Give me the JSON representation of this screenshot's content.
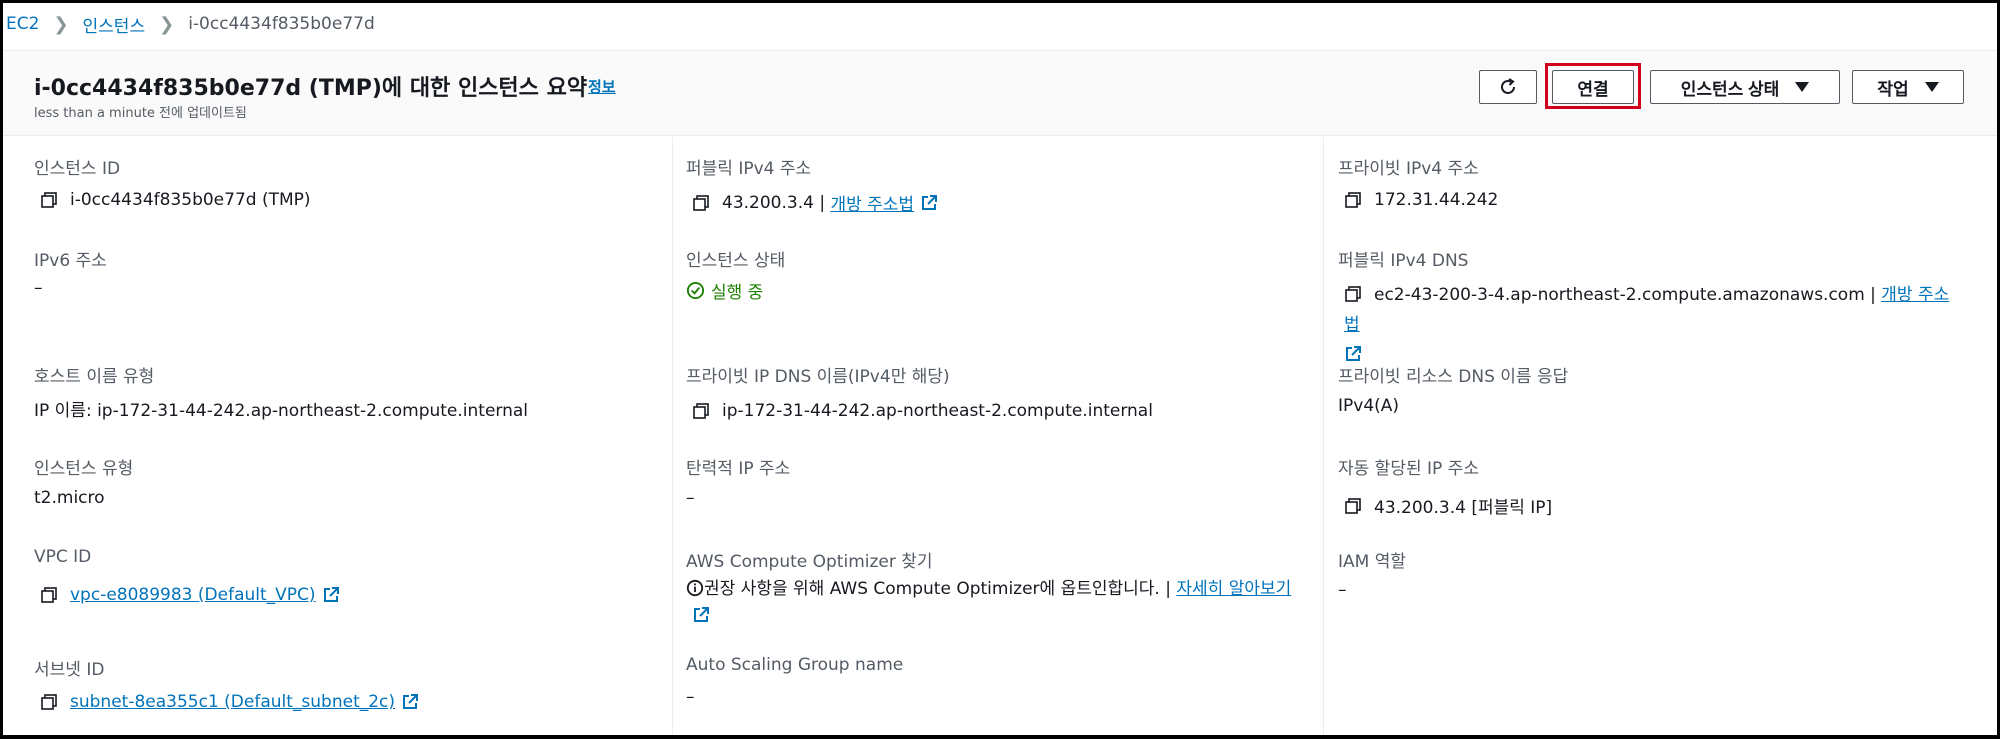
{
  "breadcrumb": {
    "root": "EC2",
    "section": "인스턴스",
    "current": "i-0cc4434f835b0e77d"
  },
  "header": {
    "title": "i-0cc4434f835b0e77d (TMP)에 대한 인스턴스 요약",
    "info_link": "정보",
    "updated": "less than a minute 전에 업데이트됨"
  },
  "actions": {
    "connect": "연결",
    "instance_state": "인스턴스 상태",
    "actions": "작업"
  },
  "col1": {
    "instance_id_label": "인스턴스 ID",
    "instance_id_value": "i-0cc4434f835b0e77d (TMP)",
    "ipv6_label": "IPv6 주소",
    "ipv6_value": "–",
    "hostname_type_label": "호스트 이름 유형",
    "hostname_type_value": "IP 이름: ip-172-31-44-242.ap-northeast-2.compute.internal",
    "instance_type_label": "인스턴스 유형",
    "instance_type_value": "t2.micro",
    "vpc_label": "VPC ID",
    "vpc_value": "vpc-e8089983 (Default_VPC)",
    "subnet_label": "서브넷 ID",
    "subnet_value": "subnet-8ea355c1 (Default_subnet_2c)"
  },
  "col2": {
    "public_ipv4_label": "퍼블릭 IPv4 주소",
    "public_ipv4_value": "43.200.3.4 |",
    "public_ipv4_link": "개방 주소법",
    "state_label": "인스턴스 상태",
    "state_value": "실행 중",
    "private_dns_label": "프라이빗 IP DNS 이름(IPv4만 해당)",
    "private_dns_value": "ip-172-31-44-242.ap-northeast-2.compute.internal",
    "elastic_ip_label": "탄력적 IP 주소",
    "elastic_ip_value": "–",
    "optimizer_label": "AWS Compute Optimizer 찾기",
    "optimizer_text": "권장 사항을 위해 AWS Compute Optimizer에 옵트인합니다. |",
    "optimizer_link": "자세히 알아보기",
    "asg_label": "Auto Scaling Group name",
    "asg_value": "–"
  },
  "col3": {
    "private_ipv4_label": "프라이빗 IPv4 주소",
    "private_ipv4_value": "172.31.44.242",
    "public_dns_label": "퍼블릭 IPv4 DNS",
    "public_dns_value": "ec2-43-200-3-4.ap-northeast-2.compute.amazonaws.com |",
    "public_dns_link": "개방 주소법",
    "resource_dns_label": "프라이빗 리소스 DNS 이름 응답",
    "resource_dns_value": "IPv4(A)",
    "auto_ip_label": "자동 할당된 IP 주소",
    "auto_ip_value": "43.200.3.4 [퍼블릭 IP]",
    "iam_label": "IAM 역할",
    "iam_value": "–"
  },
  "icons": {
    "copy": "copy-icon",
    "external": "external-link-icon",
    "refresh": "refresh-icon",
    "status_ok": "check-circle-icon",
    "info": "info-circle-icon"
  },
  "colors": {
    "link": "#0073bb",
    "running": "#1d8102",
    "highlight": "#d1001c"
  }
}
